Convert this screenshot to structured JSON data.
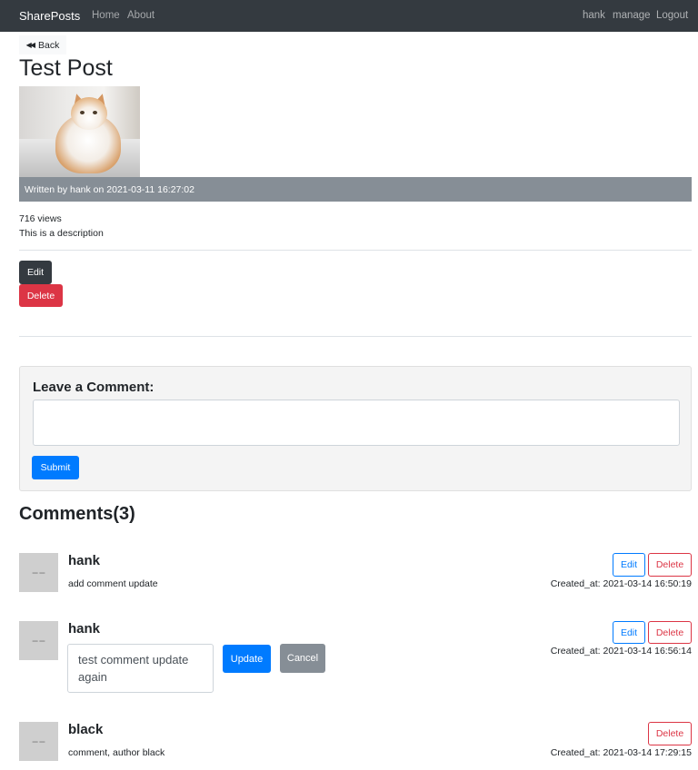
{
  "navbar": {
    "brand": "SharePosts",
    "links": [
      "Home",
      "About"
    ],
    "right_links": [
      "hank",
      "manage",
      "Logout"
    ]
  },
  "back_button": "Back",
  "post": {
    "title": "Test Post",
    "meta": "Written by hank on 2021-03-11 16:27:02",
    "views": "716 views",
    "description": "This is a description",
    "edit_label": "Edit",
    "delete_label": "Delete"
  },
  "comment_form": {
    "heading": "Leave a Comment:",
    "value": "",
    "submit_label": "Submit"
  },
  "comments_title": "Comments(3)",
  "comments": [
    {
      "author": "hank",
      "text": "add comment update",
      "created": "Created_at: 2021-03-14 16:50:19",
      "edit_label": "Edit",
      "delete_label": "Delete"
    },
    {
      "author": "hank",
      "edit_value": "test comment update again",
      "update_label": "Update",
      "cancel_label": "Cancel",
      "created": "Created_at: 2021-03-14 16:56:14",
      "edit_label": "Edit",
      "delete_label": "Delete"
    },
    {
      "author": "black",
      "text": "comment, author black",
      "created": "Created_at: 2021-03-14 17:29:15",
      "delete_label": "Delete"
    }
  ],
  "colors": {
    "navbar": "#343a40",
    "primary": "#007bff",
    "danger": "#dc3545",
    "secondary": "#868e96",
    "dark": "#343a40"
  }
}
